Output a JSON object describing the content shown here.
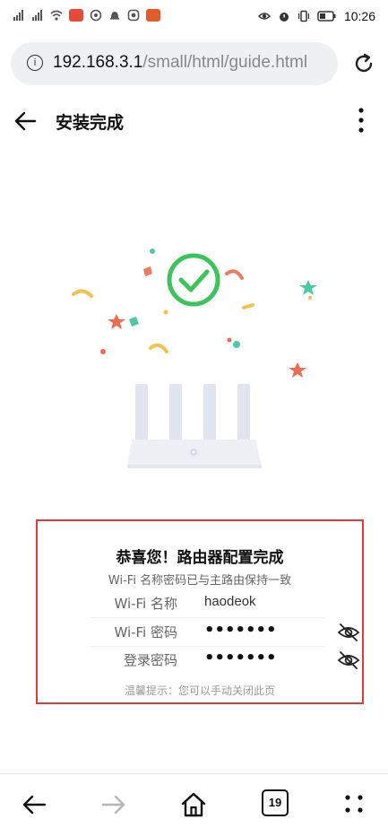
{
  "status_bar": {
    "time": "10:26",
    "left_icons": [
      "signal-icon",
      "signal-icon",
      "wifi-icon",
      "app-icon",
      "app-icon",
      "notification-icon",
      "app-icon",
      "app-icon"
    ],
    "right_icons": [
      "eye-icon",
      "alarm-icon",
      "vibrate-icon",
      "battery-icon"
    ]
  },
  "address_bar": {
    "host": "192.168.3.1",
    "path": "/small/html/guide.html"
  },
  "header": {
    "title": "安装完成"
  },
  "card": {
    "title": "恭喜您！路由器配置完成",
    "subtitle": "Wi-Fi 名称密码已与主路由保持一致",
    "rows": [
      {
        "label": "Wi-Fi 名称",
        "value": "haodeok"
      },
      {
        "label": "Wi-Fi 密码",
        "value": "•••••••"
      },
      {
        "label": "登录密码",
        "value": "•••••••"
      }
    ],
    "hint": "温馨提示：您可以手动关闭此页"
  },
  "nav": {
    "tab_count": "19"
  },
  "colors": {
    "accent_green": "#3cc35a",
    "highlight_red": "#e0393e"
  }
}
